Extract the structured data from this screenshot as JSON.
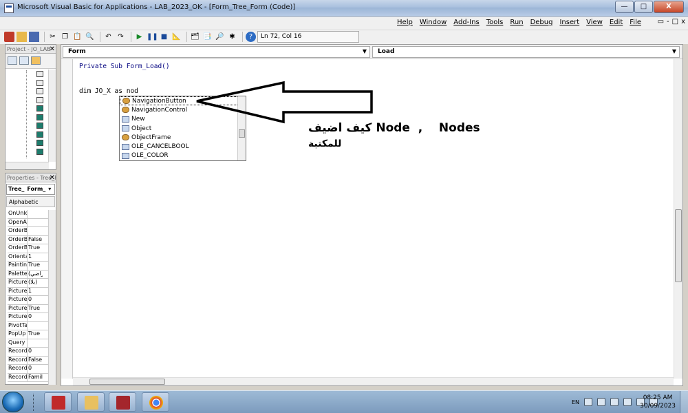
{
  "window": {
    "title": "Microsoft Visual Basic for Applications - LAB_2023_OK - [Form_Tree_Form (Code)]",
    "controls": [
      "—",
      "□",
      "X"
    ]
  },
  "menu": {
    "items": [
      "Help",
      "Window",
      "Add-Ins",
      "Tools",
      "Run",
      "Debug",
      "Insert",
      "View",
      "Edit",
      "File"
    ],
    "doc_controls": [
      "▭",
      "-",
      "□",
      "x"
    ]
  },
  "toolbar": {
    "position": "Ln 72, Col 16"
  },
  "project_pane": {
    "title": "Project - JO_LAB"
  },
  "properties_pane": {
    "title": "Properties - Tree_Form",
    "object_combo": [
      "Tree_",
      "Form_"
    ],
    "tab": "Alphabetic",
    "rows": [
      {
        "name": "OnUnload",
        "value": ""
      },
      {
        "name": "OpenArgs",
        "value": ""
      },
      {
        "name": "OrderBy",
        "value": ""
      },
      {
        "name": "OrderByOn",
        "value": "False"
      },
      {
        "name": "OrderByOnLoad",
        "value": "True"
      },
      {
        "name": "Orientation",
        "value": "1"
      },
      {
        "name": "Painting",
        "value": "True"
      },
      {
        "name": "Palette",
        "value": "(افتراضي)"
      },
      {
        "name": "Picture",
        "value": "(بلا)"
      },
      {
        "name": "PictureAlignment",
        "value": "1"
      },
      {
        "name": "PictureSizeMode",
        "value": "0"
      },
      {
        "name": "PictureTiling",
        "value": "True"
      },
      {
        "name": "PictureType",
        "value": "0"
      },
      {
        "name": "PivotTable",
        "value": ""
      },
      {
        "name": "PopUp",
        "value": "True"
      },
      {
        "name": "Query",
        "value": ""
      },
      {
        "name": "RecordLocks",
        "value": "0"
      },
      {
        "name": "RecordSelectors",
        "value": "False"
      },
      {
        "name": "RecordsetType",
        "value": "0"
      },
      {
        "name": "RecordSource",
        "value": "Family"
      }
    ]
  },
  "code_window": {
    "object_combo": "Form",
    "procedure_combo": "Load",
    "lines": {
      "kw_private": "Private",
      "kw_sub": "Sub",
      "sub_name": "Form_Load()",
      "kw_dim": "dim",
      "var_name": "JO_X",
      "kw_as": "as",
      "typed": "nod"
    }
  },
  "autocomplete": {
    "items": [
      {
        "label": "NavigationButton",
        "icon": "class-icon",
        "selected": true
      },
      {
        "label": "NavigationControl",
        "icon": "class-icon"
      },
      {
        "label": "New",
        "icon": "enum-icon"
      },
      {
        "label": "Object",
        "icon": "enum-icon"
      },
      {
        "label": "ObjectFrame",
        "icon": "class-icon"
      },
      {
        "label": "OLE_CANCELBOOL",
        "icon": "enum-icon"
      },
      {
        "label": "OLE_COLOR",
        "icon": "enum-icon"
      }
    ]
  },
  "annotation": {
    "line1": "كيف اضيف Node  ,    Nodes",
    "line2": "للمكتبة",
    "arrow_color": "#000000"
  },
  "taskbar": {
    "lang": "EN",
    "time": "08:25 AM",
    "date": "30/09/2023",
    "apps": [
      "rt-app",
      "file-explorer",
      "access",
      "chrome"
    ]
  }
}
